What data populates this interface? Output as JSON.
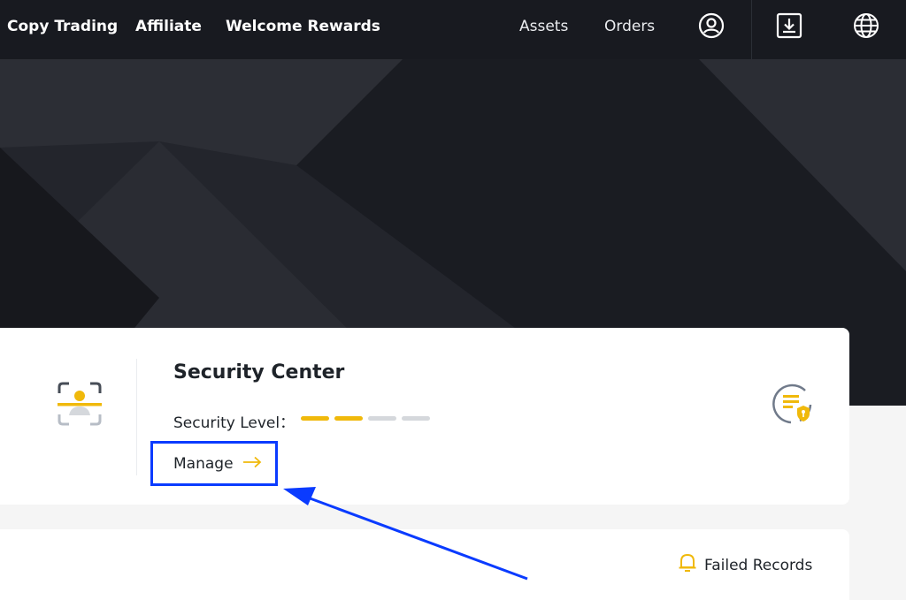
{
  "nav": {
    "links": [
      "Copy Trading",
      "Affiliate",
      "Welcome Rewards"
    ],
    "right_links": [
      "Assets",
      "Orders"
    ],
    "icons": [
      "user-circle-icon",
      "download-icon",
      "globe-icon"
    ]
  },
  "security": {
    "title": "Security Center",
    "level_label": "Security Level：",
    "level_filled": 2,
    "level_total": 4,
    "manage_label": "Manage",
    "face_icon": "face-verification-icon",
    "shield_icon": "security-document-icon"
  },
  "records": {
    "failed_label": "Failed Records",
    "icon": "bell-icon"
  },
  "colors": {
    "accent": "#f0b90b",
    "nav_bg": "#181a20",
    "hero_bg": "#1e2026",
    "highlight": "#0a3bff",
    "level_empty": "#d5d8dc"
  }
}
